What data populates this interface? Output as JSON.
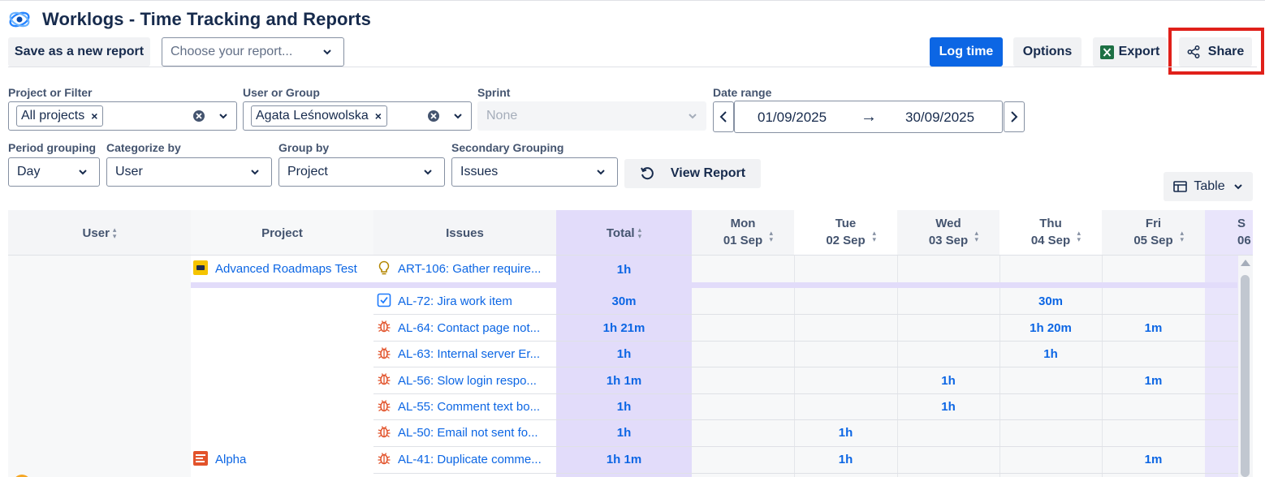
{
  "app": {
    "title": "Worklogs - Time Tracking and Reports"
  },
  "toolbar": {
    "save_new_report": "Save as a new report",
    "choose_report_placeholder": "Choose your report...",
    "log_time": "Log time",
    "options": "Options",
    "export": "Export",
    "share": "Share"
  },
  "filters": {
    "project_label": "Project or Filter",
    "project_tag": "All projects",
    "user_label": "User or Group",
    "user_tag": "Agata Leśnowolska",
    "sprint_label": "Sprint",
    "sprint_value": "None",
    "date_label": "Date range",
    "date_from": "01/09/2025",
    "date_to": "30/09/2025",
    "date_arrow": "→",
    "period_label": "Period grouping",
    "period_value": "Day",
    "categorize_label": "Categorize by",
    "categorize_value": "User",
    "group_label": "Group by",
    "group_value": "Project",
    "secondary_label": "Secondary Grouping",
    "secondary_value": "Issues",
    "view_report": "View Report",
    "view_mode": "Table"
  },
  "table": {
    "headers": {
      "user": "User",
      "project": "Project",
      "issues": "Issues",
      "total": "Total"
    },
    "days": [
      {
        "dow": "Mon",
        "date": "01 Sep"
      },
      {
        "dow": "Tue",
        "date": "02 Sep"
      },
      {
        "dow": "Wed",
        "date": "03 Sep"
      },
      {
        "dow": "Thu",
        "date": "04 Sep"
      },
      {
        "dow": "Fri",
        "date": "05 Sep"
      },
      {
        "dow": "S",
        "date": "06"
      }
    ],
    "projects": [
      {
        "name": "Advanced Roadmaps Test",
        "color": "#f5c400"
      },
      {
        "name": "Alpha",
        "color": "#e2532b"
      }
    ],
    "rows": [
      {
        "issue": "ART-106: Gather require...",
        "type": "idea",
        "total": "1h",
        "mon": "",
        "tue": "",
        "wed": "",
        "thu": "",
        "fri": ""
      },
      {
        "issue": "AL-72: Jira work item",
        "type": "task",
        "total": "30m",
        "mon": "",
        "tue": "",
        "wed": "",
        "thu": "30m",
        "fri": ""
      },
      {
        "issue": "AL-64: Contact page not...",
        "type": "bug",
        "total": "1h 21m",
        "mon": "",
        "tue": "",
        "wed": "",
        "thu": "1h 20m",
        "fri": "1m"
      },
      {
        "issue": "AL-63: Internal server Er...",
        "type": "bug",
        "total": "1h",
        "mon": "",
        "tue": "",
        "wed": "",
        "thu": "1h",
        "fri": ""
      },
      {
        "issue": "AL-56: Slow login respo...",
        "type": "bug",
        "total": "1h 1m",
        "mon": "",
        "tue": "",
        "wed": "1h",
        "thu": "",
        "fri": "1m"
      },
      {
        "issue": "AL-55: Comment text bo...",
        "type": "bug",
        "total": "1h",
        "mon": "",
        "tue": "",
        "wed": "1h",
        "thu": "",
        "fri": ""
      },
      {
        "issue": "AL-50: Email not sent fo...",
        "type": "bug",
        "total": "1h",
        "mon": "",
        "tue": "1h",
        "wed": "",
        "thu": "",
        "fri": ""
      },
      {
        "issue": "AL-41: Duplicate comme...",
        "type": "bug",
        "total": "1h 1m",
        "mon": "",
        "tue": "1h",
        "wed": "",
        "thu": "",
        "fri": "1m"
      }
    ]
  },
  "colors": {
    "primary": "#0c66e4",
    "total_column": "#e2dcfa",
    "highlight": "#e0201a",
    "bug": "#e2532b",
    "idea": "#b38600"
  }
}
